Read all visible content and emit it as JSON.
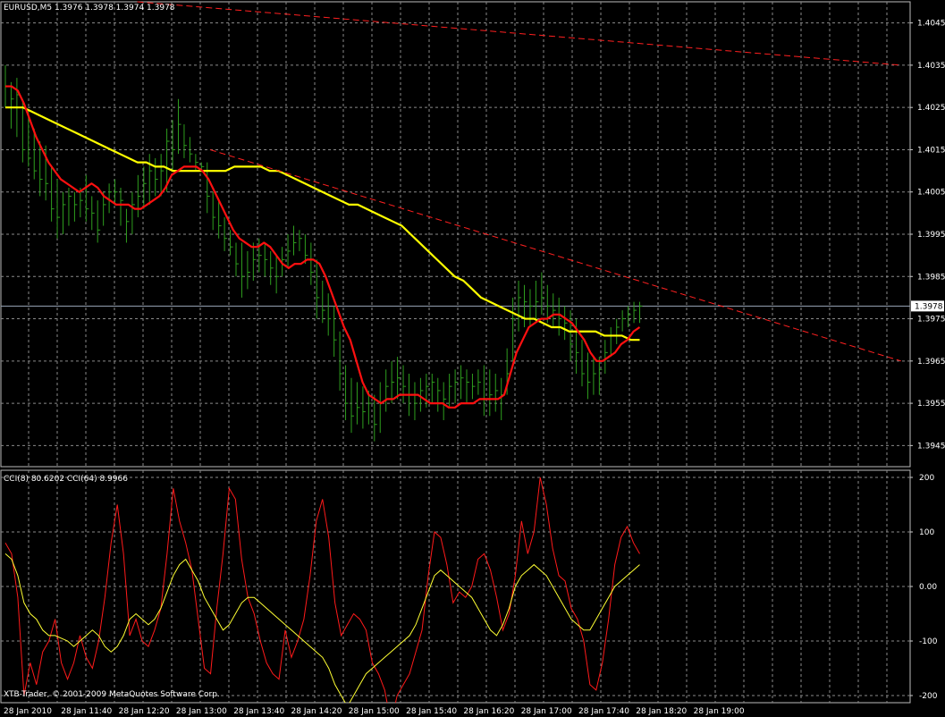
{
  "window": {
    "header": "EURUSD,M5  1.3976 1.3978 1.3974 1.3978",
    "indicator_header": "CCI(8) 80.6202  CCI(64) 8.9966",
    "copyright": "XTB-Trader, © 2001-2009 MetaQuotes Software Corp."
  },
  "colors": {
    "background": "#000000",
    "grid": "#8a8a8a",
    "bars": "#2e9e1e",
    "ma_fast": "#ff1010",
    "ma_slow": "#ffff00",
    "trend": "#ff2020",
    "cci_fast": "#ff1a1a",
    "cci_slow": "#ffff33",
    "current_price_line": "#9aa6b8"
  },
  "chart_data": [
    {
      "type": "line",
      "instrument": "EURUSD",
      "timeframe": "M5",
      "ylim": [
        1.394,
        1.405
      ],
      "y_ticks": [
        "1.4045",
        "1.4035",
        "1.4025",
        "1.4015",
        "1.4005",
        "1.3995",
        "1.3985",
        "1.3975",
        "1.3965",
        "1.3955",
        "1.3945"
      ],
      "current_price": "1.3978",
      "x_ticks": [
        "28 Jan 2010",
        "28 Jan 11:40",
        "28 Jan 12:20",
        "28 Jan 13:00",
        "28 Jan 13:40",
        "28 Jan 14:20",
        "28 Jan 15:00",
        "28 Jan 15:40",
        "28 Jan 16:20",
        "28 Jan 17:00",
        "28 Jan 17:40",
        "28 Jan 18:20",
        "28 Jan 19:00"
      ],
      "bars": [
        {
          "h": 1.4035,
          "l": 1.4025,
          "c": 1.403
        },
        {
          "h": 1.4031,
          "l": 1.402,
          "c": 1.4027
        },
        {
          "h": 1.4032,
          "l": 1.4018,
          "c": 1.4028
        },
        {
          "h": 1.4027,
          "l": 1.4012,
          "c": 1.4015
        },
        {
          "h": 1.4024,
          "l": 1.4011,
          "c": 1.4013
        },
        {
          "h": 1.402,
          "l": 1.4008,
          "c": 1.401
        },
        {
          "h": 1.4017,
          "l": 1.4004,
          "c": 1.4008
        },
        {
          "h": 1.4016,
          "l": 1.4003,
          "c": 1.4007
        },
        {
          "h": 1.4011,
          "l": 1.3998,
          "c": 1.4001
        },
        {
          "h": 1.4008,
          "l": 1.3994,
          "c": 1.3999
        },
        {
          "h": 1.4005,
          "l": 1.3995,
          "c": 1.4002
        },
        {
          "h": 1.4006,
          "l": 1.3997,
          "c": 1.4004
        },
        {
          "h": 1.4005,
          "l": 1.3998,
          "c": 1.4002
        },
        {
          "h": 1.4006,
          "l": 1.3999,
          "c": 1.4003
        },
        {
          "h": 1.4009,
          "l": 1.3998,
          "c": 1.4001
        },
        {
          "h": 1.4004,
          "l": 1.3996,
          "c": 1.4
        },
        {
          "h": 1.4003,
          "l": 1.3993,
          "c": 1.3996
        },
        {
          "h": 1.4005,
          "l": 1.3997,
          "c": 1.4002
        },
        {
          "h": 1.4007,
          "l": 1.4,
          "c": 1.4005
        },
        {
          "h": 1.4008,
          "l": 1.4002,
          "c": 1.4005
        },
        {
          "h": 1.4006,
          "l": 1.3997,
          "c": 1.4003
        },
        {
          "h": 1.4001,
          "l": 1.3993,
          "c": 1.3998
        },
        {
          "h": 1.4005,
          "l": 1.3995,
          "c": 1.4002
        },
        {
          "h": 1.4009,
          "l": 1.3999,
          "c": 1.4004
        },
        {
          "h": 1.4011,
          "l": 1.4001,
          "c": 1.4007
        },
        {
          "h": 1.4014,
          "l": 1.4002,
          "c": 1.401
        },
        {
          "h": 1.4013,
          "l": 1.4004,
          "c": 1.4008
        },
        {
          "h": 1.4014,
          "l": 1.4004,
          "c": 1.401
        },
        {
          "h": 1.402,
          "l": 1.4005,
          "c": 1.4017
        },
        {
          "h": 1.4022,
          "l": 1.401,
          "c": 1.4015
        },
        {
          "h": 1.4027,
          "l": 1.4014,
          "c": 1.4021
        },
        {
          "h": 1.4021,
          "l": 1.4013,
          "c": 1.4016
        },
        {
          "h": 1.4018,
          "l": 1.4012,
          "c": 1.4014
        },
        {
          "h": 1.4014,
          "l": 1.401,
          "c": 1.4012
        },
        {
          "h": 1.4012,
          "l": 1.401,
          "c": 1.4011
        },
        {
          "h": 1.4012,
          "l": 1.4,
          "c": 1.4004
        },
        {
          "h": 1.4005,
          "l": 1.3996,
          "c": 1.3999
        },
        {
          "h": 1.4003,
          "l": 1.3994,
          "c": 1.3997
        },
        {
          "h": 1.3999,
          "l": 1.3991,
          "c": 1.3994
        },
        {
          "h": 1.3996,
          "l": 1.399,
          "c": 1.3992
        },
        {
          "h": 1.3993,
          "l": 1.3985,
          "c": 1.3988
        },
        {
          "h": 1.3993,
          "l": 1.398,
          "c": 1.3985
        },
        {
          "h": 1.3991,
          "l": 1.3982,
          "c": 1.3986
        },
        {
          "h": 1.3993,
          "l": 1.3984,
          "c": 1.3989
        },
        {
          "h": 1.3994,
          "l": 1.3986,
          "c": 1.399
        },
        {
          "h": 1.3993,
          "l": 1.3985,
          "c": 1.3989
        },
        {
          "h": 1.3991,
          "l": 1.3983,
          "c": 1.3987
        },
        {
          "h": 1.399,
          "l": 1.3981,
          "c": 1.3985
        },
        {
          "h": 1.3992,
          "l": 1.3985,
          "c": 1.3989
        },
        {
          "h": 1.3995,
          "l": 1.3987,
          "c": 1.3991
        },
        {
          "h": 1.3997,
          "l": 1.399,
          "c": 1.3993
        },
        {
          "h": 1.3996,
          "l": 1.3991,
          "c": 1.3994
        },
        {
          "h": 1.3995,
          "l": 1.3988,
          "c": 1.399
        },
        {
          "h": 1.3993,
          "l": 1.3983,
          "c": 1.3986
        },
        {
          "h": 1.3989,
          "l": 1.3975,
          "c": 1.398
        },
        {
          "h": 1.3984,
          "l": 1.3974,
          "c": 1.3977
        },
        {
          "h": 1.3981,
          "l": 1.3971,
          "c": 1.3975
        },
        {
          "h": 1.3978,
          "l": 1.3966,
          "c": 1.397
        },
        {
          "h": 1.3972,
          "l": 1.3958,
          "c": 1.3962
        },
        {
          "h": 1.3964,
          "l": 1.3951,
          "c": 1.3955
        },
        {
          "h": 1.3961,
          "l": 1.3948,
          "c": 1.3952
        },
        {
          "h": 1.396,
          "l": 1.395,
          "c": 1.3954
        },
        {
          "h": 1.3959,
          "l": 1.3949,
          "c": 1.3953
        },
        {
          "h": 1.3958,
          "l": 1.395,
          "c": 1.3955
        },
        {
          "h": 1.3957,
          "l": 1.3946,
          "c": 1.395
        },
        {
          "h": 1.396,
          "l": 1.3948,
          "c": 1.3955
        },
        {
          "h": 1.3963,
          "l": 1.3953,
          "c": 1.3959
        },
        {
          "h": 1.3965,
          "l": 1.3955,
          "c": 1.396
        },
        {
          "h": 1.3966,
          "l": 1.3956,
          "c": 1.3961
        },
        {
          "h": 1.3964,
          "l": 1.3955,
          "c": 1.3959
        },
        {
          "h": 1.3962,
          "l": 1.3952,
          "c": 1.3957
        },
        {
          "h": 1.396,
          "l": 1.3951,
          "c": 1.3955
        },
        {
          "h": 1.3961,
          "l": 1.3953,
          "c": 1.3958
        },
        {
          "h": 1.3962,
          "l": 1.3954,
          "c": 1.3959
        },
        {
          "h": 1.3962,
          "l": 1.3955,
          "c": 1.396
        },
        {
          "h": 1.3961,
          "l": 1.3953,
          "c": 1.3958
        },
        {
          "h": 1.396,
          "l": 1.3951,
          "c": 1.3956
        },
        {
          "h": 1.3962,
          "l": 1.3954,
          "c": 1.3959
        },
        {
          "h": 1.3963,
          "l": 1.3955,
          "c": 1.396
        },
        {
          "h": 1.3964,
          "l": 1.3956,
          "c": 1.3961
        },
        {
          "h": 1.3963,
          "l": 1.3955,
          "c": 1.396
        },
        {
          "h": 1.3962,
          "l": 1.3956,
          "c": 1.3959
        },
        {
          "h": 1.3963,
          "l": 1.3957,
          "c": 1.396
        },
        {
          "h": 1.3964,
          "l": 1.3952,
          "c": 1.3956
        },
        {
          "h": 1.3963,
          "l": 1.3952,
          "c": 1.3957
        },
        {
          "h": 1.3962,
          "l": 1.3953,
          "c": 1.3958
        },
        {
          "h": 1.3961,
          "l": 1.3951,
          "c": 1.3957
        },
        {
          "h": 1.3968,
          "l": 1.3957,
          "c": 1.3962
        },
        {
          "h": 1.398,
          "l": 1.3965,
          "c": 1.3975
        },
        {
          "h": 1.3984,
          "l": 1.3972,
          "c": 1.398
        },
        {
          "h": 1.3983,
          "l": 1.3973,
          "c": 1.3979
        },
        {
          "h": 1.3982,
          "l": 1.3973,
          "c": 1.3978
        },
        {
          "h": 1.3984,
          "l": 1.3974,
          "c": 1.3979
        },
        {
          "h": 1.3986,
          "l": 1.3976,
          "c": 1.398
        },
        {
          "h": 1.3983,
          "l": 1.3974,
          "c": 1.3978
        },
        {
          "h": 1.3981,
          "l": 1.3973,
          "c": 1.3977
        },
        {
          "h": 1.398,
          "l": 1.3971,
          "c": 1.3975
        },
        {
          "h": 1.3978,
          "l": 1.397,
          "c": 1.3974
        },
        {
          "h": 1.3977,
          "l": 1.3965,
          "c": 1.3969
        },
        {
          "h": 1.3975,
          "l": 1.3962,
          "c": 1.3967
        },
        {
          "h": 1.397,
          "l": 1.3959,
          "c": 1.3962
        },
        {
          "h": 1.3967,
          "l": 1.3956,
          "c": 1.396
        },
        {
          "h": 1.3966,
          "l": 1.3957,
          "c": 1.3962
        },
        {
          "h": 1.3966,
          "l": 1.3957,
          "c": 1.3963
        },
        {
          "h": 1.397,
          "l": 1.3962,
          "c": 1.3967
        },
        {
          "h": 1.3973,
          "l": 1.3966,
          "c": 1.3971
        },
        {
          "h": 1.3975,
          "l": 1.3969,
          "c": 1.3973
        },
        {
          "h": 1.3977,
          "l": 1.3972,
          "c": 1.3975
        },
        {
          "h": 1.3978,
          "l": 1.3973,
          "c": 1.3976
        },
        {
          "h": 1.3979,
          "l": 1.3974,
          "c": 1.3977
        },
        {
          "h": 1.3979,
          "l": 1.3974,
          "c": 1.3978
        }
      ],
      "ma_fast": [
        1.403,
        1.403,
        1.4029,
        1.4026,
        1.4022,
        1.4018,
        1.4015,
        1.4012,
        1.401,
        1.4008,
        1.4007,
        1.4006,
        1.4005,
        1.4006,
        1.4007,
        1.4006,
        1.4004,
        1.4003,
        1.4002,
        1.4002,
        1.4002,
        1.4001,
        1.4001,
        1.4002,
        1.4003,
        1.4004,
        1.4006,
        1.4009,
        1.401,
        1.4011,
        1.4011,
        1.4011,
        1.401,
        1.4008,
        1.4005,
        1.4002,
        1.3999,
        1.3996,
        1.3994,
        1.3993,
        1.3992,
        1.3992,
        1.3993,
        1.3992,
        1.399,
        1.3988,
        1.3987,
        1.3988,
        1.3988,
        1.3989,
        1.3989,
        1.3988,
        1.3985,
        1.3981,
        1.3977,
        1.3973,
        1.397,
        1.3965,
        1.396,
        1.3957,
        1.3956,
        1.3955,
        1.3956,
        1.3956,
        1.3957,
        1.3957,
        1.3957,
        1.3957,
        1.3956,
        1.3955,
        1.3955,
        1.3955,
        1.3954,
        1.3954,
        1.3955,
        1.3955,
        1.3955,
        1.3956,
        1.3956,
        1.3956,
        1.3956,
        1.3957,
        1.3962,
        1.3967,
        1.397,
        1.3973,
        1.3974,
        1.3975,
        1.3975,
        1.3976,
        1.3976,
        1.3975,
        1.3974,
        1.3972,
        1.397,
        1.3967,
        1.3965,
        1.3965,
        1.3966,
        1.3967,
        1.3969,
        1.397,
        1.3972,
        1.3973
      ],
      "ma_slow": [
        1.4025,
        1.4025,
        1.4025,
        1.4024,
        1.4023,
        1.4022,
        1.4021,
        1.402,
        1.4019,
        1.4018,
        1.4017,
        1.4016,
        1.4015,
        1.4014,
        1.4013,
        1.4012,
        1.4012,
        1.4011,
        1.4011,
        1.401,
        1.401,
        1.401,
        1.401,
        1.401,
        1.401,
        1.401,
        1.4011,
        1.4011,
        1.4011,
        1.4011,
        1.401,
        1.401,
        1.4009,
        1.4008,
        1.4007,
        1.4006,
        1.4005,
        1.4004,
        1.4003,
        1.4002,
        1.4002,
        1.4001,
        1.4,
        1.3999,
        1.3998,
        1.3997,
        1.3995,
        1.3993,
        1.3991,
        1.3989,
        1.3987,
        1.3985,
        1.3984,
        1.3982,
        1.398,
        1.3979,
        1.3978,
        1.3977,
        1.3976,
        1.3975,
        1.3975,
        1.3974,
        1.3973,
        1.3973,
        1.3972,
        1.3972,
        1.3972,
        1.3972,
        1.3971,
        1.3971,
        1.3971,
        1.397,
        1.397
      ],
      "trendlines": [
        {
          "from": [
            1.405,
            0.15
          ],
          "to": [
            1.4035,
            0.99
          ]
        },
        {
          "from": [
            1.4015,
            0.23
          ],
          "to": [
            1.3965,
            0.99
          ]
        }
      ]
    },
    {
      "type": "line",
      "ylim": [
        -200,
        200
      ],
      "y_ticks": [
        "200",
        "100",
        "0.00",
        "-100",
        "-200"
      ],
      "series": [
        {
          "name": "CCI(8)",
          "values": [
            80,
            60,
            -20,
            -200,
            -140,
            -180,
            -120,
            -100,
            -60,
            -140,
            -170,
            -140,
            -90,
            -130,
            -150,
            -100,
            -20,
            80,
            150,
            60,
            -90,
            -60,
            -100,
            -110,
            -80,
            -40,
            60,
            180,
            120,
            80,
            30,
            -60,
            -150,
            -160,
            -40,
            60,
            180,
            160,
            50,
            -20,
            -50,
            -100,
            -140,
            -160,
            -170,
            -80,
            -130,
            -100,
            -60,
            20,
            120,
            160,
            90,
            -30,
            -90,
            -70,
            -50,
            -60,
            -80,
            -140,
            -160,
            -190,
            -250,
            -200,
            -180,
            -160,
            -120,
            -80,
            20,
            100,
            90,
            40,
            -30,
            -10,
            -20,
            0,
            50,
            60,
            30,
            -20,
            -80,
            -50,
            20,
            120,
            60,
            100,
            200,
            150,
            70,
            20,
            10,
            -40,
            -60,
            -100,
            -180,
            -190,
            -140,
            -60,
            40,
            90,
            110,
            80,
            60
          ]
        },
        {
          "name": "CCI(64)",
          "values": [
            60,
            50,
            20,
            -30,
            -50,
            -60,
            -80,
            -90,
            -90,
            -95,
            -100,
            -110,
            -100,
            -90,
            -80,
            -90,
            -110,
            -120,
            -110,
            -90,
            -60,
            -50,
            -60,
            -70,
            -60,
            -40,
            -10,
            20,
            40,
            50,
            30,
            10,
            -20,
            -40,
            -60,
            -80,
            -70,
            -50,
            -30,
            -20,
            -20,
            -30,
            -40,
            -50,
            -60,
            -70,
            -80,
            -90,
            -100,
            -110,
            -120,
            -130,
            -150,
            -180,
            -200,
            -220,
            -200,
            -180,
            -160,
            -150,
            -140,
            -130,
            -120,
            -110,
            -100,
            -90,
            -70,
            -40,
            -10,
            20,
            30,
            20,
            10,
            0,
            -10,
            -20,
            -40,
            -60,
            -80,
            -90,
            -70,
            -40,
            0,
            20,
            30,
            40,
            30,
            20,
            0,
            -20,
            -40,
            -60,
            -70,
            -80,
            -80,
            -60,
            -40,
            -20,
            0,
            10,
            20,
            30,
            40
          ]
        }
      ]
    }
  ]
}
